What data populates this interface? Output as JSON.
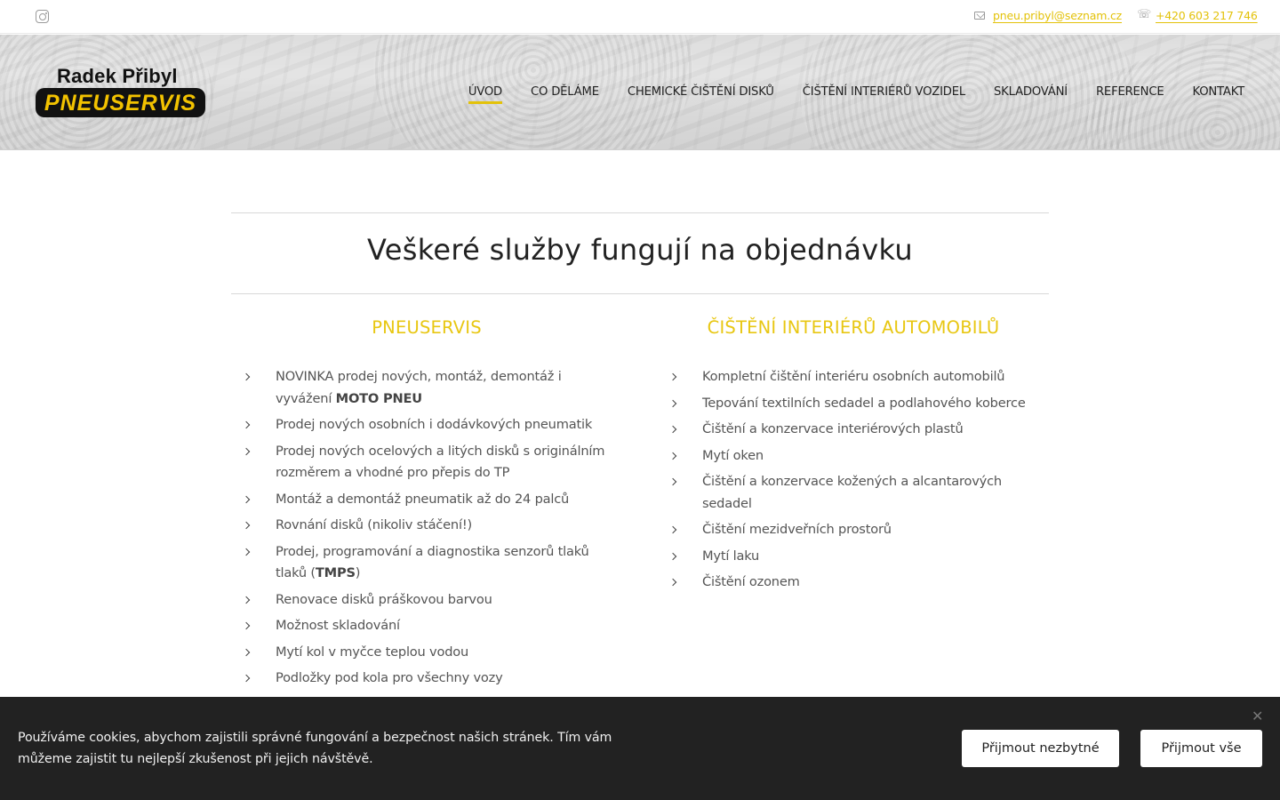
{
  "topbar": {
    "email": "pneu.pribyl@seznam.cz",
    "phone": "+420 603 217 746",
    "phone_icon": "☏"
  },
  "logo": {
    "name": "Radek Přibyl",
    "brand": "PNEUSERVIS"
  },
  "nav": [
    {
      "label": "ÚVOD",
      "active": true
    },
    {
      "label": "CO DĚLÁME"
    },
    {
      "label": "CHEMICKÉ ČIŠTĚNÍ DISKŮ"
    },
    {
      "label": "ČIŠTĚNÍ INTERIÉRŮ VOZIDEL"
    },
    {
      "label": "SKLADOVÁNÍ"
    },
    {
      "label": "REFERENCE"
    },
    {
      "label": "KONTAKT"
    }
  ],
  "main": {
    "title": "Veškeré služby fungují na objednávku",
    "left": {
      "heading": "PNEUSERVIS",
      "items": [
        {
          "text": "NOVINKA prodej nových, montáž, demontáž i vyvážení ",
          "bold": "MOTO PNEU",
          "after": ""
        },
        {
          "text": "Prodej nových osobních i dodávkových pneumatik"
        },
        {
          "text": "Prodej nových ocelových a litých disků s originálním rozměrem a vhodné pro přepis do TP"
        },
        {
          "text": "Montáž a demontáž pneumatik až do 24 palců"
        },
        {
          "text": "Rovnání disků (nikoliv stáčení!)"
        },
        {
          "text": "Prodej, programování a diagnostika senzorů tlaků tlaků (",
          "bold": "TMPS",
          "after": ")"
        },
        {
          "text": "Renovace disků práškovou barvou"
        },
        {
          "text": "Možnost skladování"
        },
        {
          "text": "Mytí kol v myčce teplou vodou"
        },
        {
          "text": "Podložky pod kola pro všechny vozy"
        }
      ]
    },
    "right": {
      "heading": "ČIŠTĚNÍ INTERIÉRŮ AUTOMOBILŮ",
      "items": [
        {
          "text": "Kompletní čištění interiéru osobních automobilů"
        },
        {
          "text": "Tepování textilních sedadel a podlahového koberce"
        },
        {
          "text": "Čištění a konzervace interiérových plastů"
        },
        {
          "text": "Mytí oken"
        },
        {
          "text": "Čištění a konzervace kožených a alcantarových sedadel"
        },
        {
          "text": "Čištění mezidveřních prostorů"
        },
        {
          "text": "Mytí laku"
        },
        {
          "text": "Čištění ozonem"
        }
      ]
    }
  },
  "cookie": {
    "text": "Používáme cookies, abychom zajistili správné fungování a bezpečnost našich stránek. Tím vám můžeme zajistit tu nejlepší zkušenost při jejich návštěvě.",
    "close": "✕",
    "btn_necessary": "Přijmout nezbytné",
    "btn_all": "Přijmout vše"
  },
  "colors": {
    "accent": "#e3c20a",
    "cookie_bg": "#222222"
  }
}
